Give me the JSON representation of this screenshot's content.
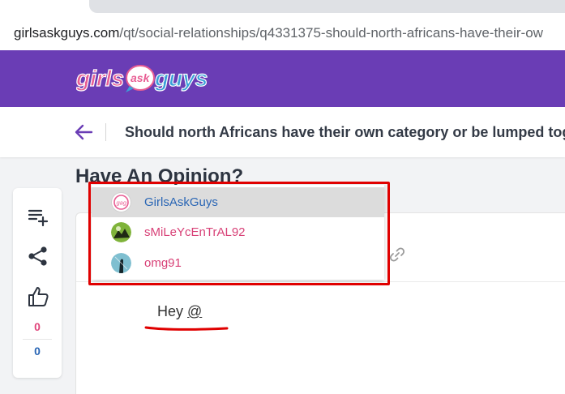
{
  "browser": {
    "url_host": "girlsaskguys.com",
    "url_path": "/qt/social-relationships/q4331375-should-north-africans-have-their-ow"
  },
  "brand": {
    "logo_text_left": "girls",
    "logo_text_mid": "ask",
    "logo_text_right": "guys",
    "bar_color": "#6a3db5"
  },
  "question": {
    "title": "Should north Africans have their own category or be lumped toge"
  },
  "section": {
    "heading": "Have An Opinion?"
  },
  "sidebar": {
    "add_icon": "playlist-add-icon",
    "share_icon": "share-icon",
    "like_icon": "thumbs-up-icon",
    "count_top": "0",
    "count_bottom": "0"
  },
  "editor": {
    "typed_prefix": "Hey ",
    "typed_mention": "@",
    "link_icon": "link-icon"
  },
  "mention_dropdown": {
    "items": [
      {
        "name": "GirlsAskGuys",
        "avatar": "gag-logo-avatar"
      },
      {
        "name": "sMiLeYcEnTrAL92",
        "avatar": "user-avatar"
      },
      {
        "name": "omg91",
        "avatar": "user-avatar"
      }
    ]
  },
  "annotations": {
    "highlight_color": "#e00000"
  }
}
